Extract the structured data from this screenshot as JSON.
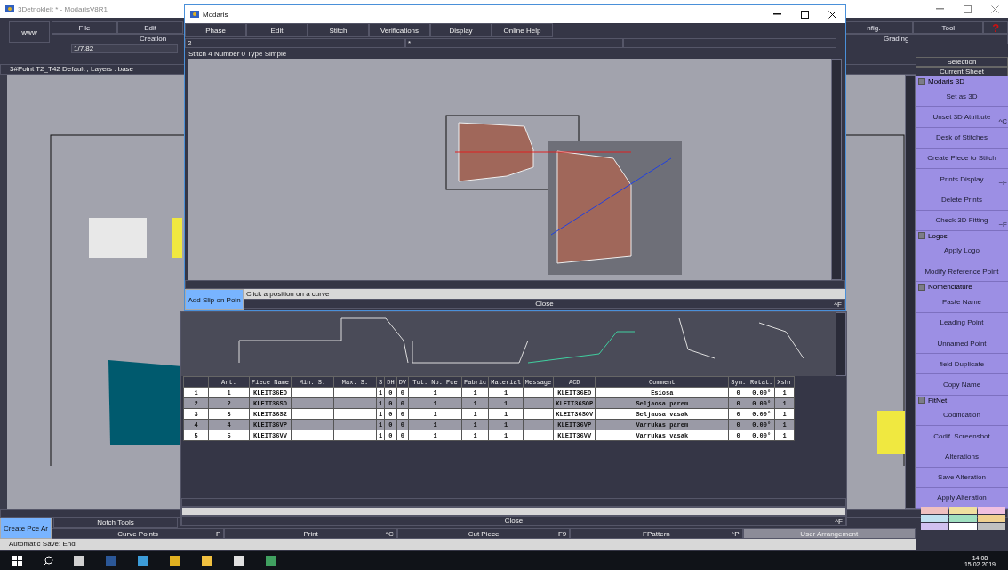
{
  "main_window": {
    "title": "3Detnokleit *  - ModarisV8R1",
    "logo_button": "www",
    "menu": [
      {
        "label": "File"
      },
      {
        "label": "Edit"
      },
      {
        "label": "nfig."
      },
      {
        "label": "Tool"
      }
    ],
    "help": "?",
    "submenu": [
      "Creation",
      "Grading"
    ],
    "scale": "1/7.82",
    "status": "3#Point T2_T42 Default ;    Layers :  base",
    "right_panel": {
      "header": "Selection",
      "sheet": "Current Sheet",
      "items": [
        {
          "kind": "group",
          "label": "Modaris 3D",
          "checked": false
        },
        {
          "kind": "button",
          "label": "Set as 3D"
        },
        {
          "kind": "button",
          "label": "Unset 3D Attribute",
          "shortcut": "^C"
        },
        {
          "kind": "button",
          "label": "Desk of Stitches"
        },
        {
          "kind": "button",
          "label": "Create Piece to Stitch"
        },
        {
          "kind": "button",
          "label": "Prints Display",
          "shortcut": "~F"
        },
        {
          "kind": "button",
          "label": "Delete Prints"
        },
        {
          "kind": "button",
          "label": "Check 3D Fitting",
          "shortcut": "~F"
        },
        {
          "kind": "group",
          "label": "Logos",
          "checked": false
        },
        {
          "kind": "button",
          "label": "Apply Logo"
        },
        {
          "kind": "button",
          "label": "Modify Reference Point"
        },
        {
          "kind": "group",
          "label": "Nomenclature",
          "checked": false
        },
        {
          "kind": "button",
          "label": "Paste Name"
        },
        {
          "kind": "button",
          "label": "Leading Point"
        },
        {
          "kind": "button",
          "label": "Unnamed Point"
        },
        {
          "kind": "button",
          "label": "field Duplicate"
        },
        {
          "kind": "button",
          "label": "Copy Name"
        },
        {
          "kind": "group",
          "label": "FitNet",
          "checked": false
        },
        {
          "kind": "button",
          "label": "Codification"
        },
        {
          "kind": "button",
          "label": "Codif. Screenshot"
        },
        {
          "kind": "button",
          "label": "Alterations"
        },
        {
          "kind": "button",
          "label": "Save Alteration"
        },
        {
          "kind": "button",
          "label": "Apply Alteration"
        }
      ]
    },
    "bottom": {
      "create_button": "Create Pce Ar",
      "notch_tools": "Notch Tools",
      "tools": [
        {
          "label": "Curve Points",
          "shortcut": "P",
          "selected": false
        },
        {
          "label": "Print",
          "shortcut": "^C",
          "selected": false
        },
        {
          "label": "Cut Piece",
          "shortcut": "~F9",
          "selected": false
        },
        {
          "label": "FPattern",
          "shortcut": "^P",
          "selected": false
        },
        {
          "label": "User Arrangement",
          "selected": true
        }
      ],
      "autosave": "Automatic Save: End"
    }
  },
  "dialog": {
    "title": "Modaris",
    "menu": [
      "Phase",
      "Edit",
      "Stitch",
      "Verifications",
      "Display",
      "Online Help"
    ],
    "field_1": "2",
    "field_2": "*",
    "info": "Stitch 4 Number 0 Type Simple",
    "action_button": "Add Slip on Poin",
    "prompt": "Click a position on a curve",
    "close": "Close",
    "close_shortcut": "^F"
  },
  "table_panel": {
    "columns": [
      "",
      "Art.",
      "Piece Name",
      "Min. S.",
      "Max. S.",
      "S",
      "DH",
      "DV",
      "Tot. Nb. Pce",
      "Fabric",
      "Material",
      "Message",
      "ACD",
      "Comment",
      "Sym.",
      "Rotat.",
      "Xshr"
    ],
    "rows": [
      {
        "selected": false,
        "cells": [
          "1",
          "1",
          "KLEIT36EO",
          "",
          "",
          "1",
          "0",
          "0",
          "1",
          "1",
          "1",
          "",
          "KLEIT36EO",
          "Esiosa",
          "0",
          "0.00°",
          "1"
        ]
      },
      {
        "selected": true,
        "cells": [
          "2",
          "2",
          "KLEIT36SO",
          "",
          "",
          "1",
          "0",
          "0",
          "1",
          "1",
          "1",
          "",
          "KLEIT36SOP",
          "Seljaosa parem",
          "0",
          "0.00°",
          "1"
        ]
      },
      {
        "selected": false,
        "cells": [
          "3",
          "3",
          "KLEIT36S2",
          "",
          "",
          "1",
          "0",
          "0",
          "1",
          "1",
          "1",
          "",
          "KLEIT36SOV",
          "Seljaosa vasak",
          "0",
          "0.00°",
          "1"
        ]
      },
      {
        "selected": true,
        "cells": [
          "4",
          "4",
          "KLEIT36VP",
          "",
          "",
          "1",
          "0",
          "0",
          "1",
          "1",
          "1",
          "",
          "KLEIT36VP",
          "Varrukas parem",
          "0",
          "0.00°",
          "1"
        ]
      },
      {
        "selected": false,
        "cells": [
          "5",
          "5",
          "KLEIT36VV",
          "",
          "",
          "1",
          "0",
          "0",
          "1",
          "1",
          "1",
          "",
          "KLEIT36VV",
          "Varrukas vasak",
          "0",
          "0.00°",
          "1"
        ]
      }
    ],
    "close": "Close",
    "close_shortcut": "^F"
  },
  "taskbar": {
    "time": "14:08",
    "date": "15.02.2019"
  }
}
